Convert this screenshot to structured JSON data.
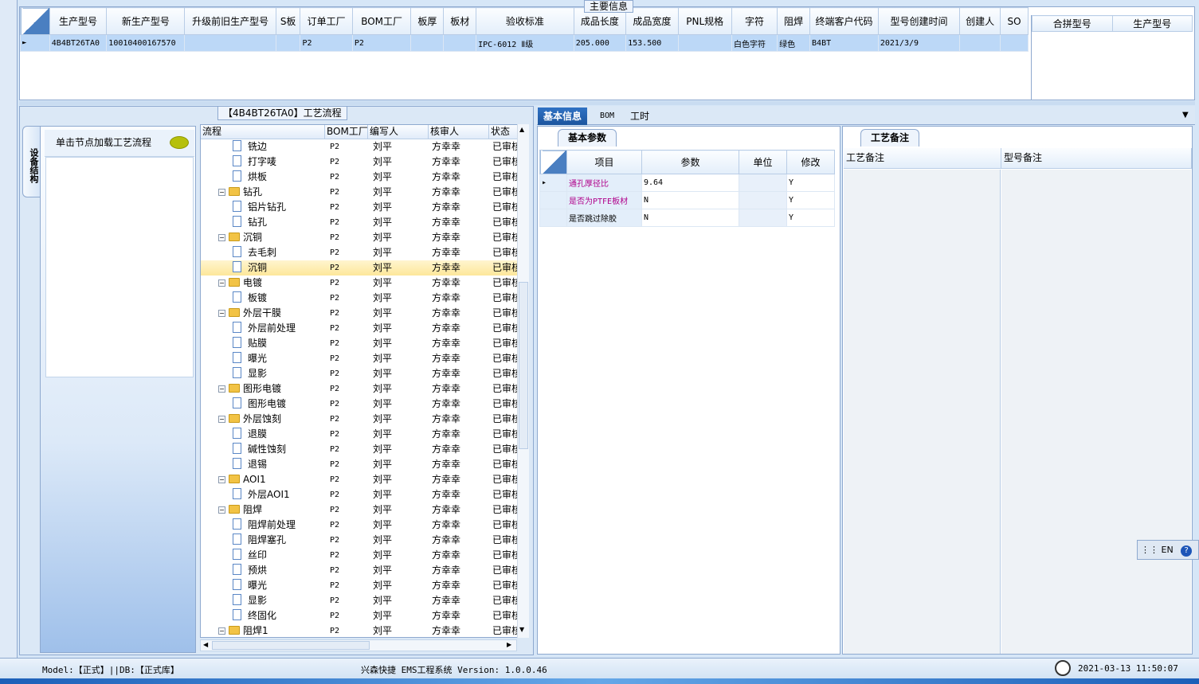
{
  "main_info": {
    "group_title": "主要信息",
    "columns": [
      "生产型号",
      "新生产型号",
      "升级前旧生产型号",
      "S板",
      "订单工厂",
      "BOM工厂",
      "板厚",
      "板材",
      "验收标准",
      "成品长度",
      "成品宽度",
      "PNL规格",
      "字符",
      "阻焊",
      "终端客户代码",
      "型号创建时间",
      "创建人",
      "SO"
    ],
    "row": [
      "4B4BT26TA0",
      "10010400167570",
      "",
      "",
      "P2",
      "P2",
      "",
      "",
      "IPC-6012 Ⅱ级",
      "205.000",
      "153.500",
      "",
      "白色字符",
      "绿色",
      "B4BT",
      "2021/3/9",
      "",
      ""
    ],
    "merge_columns": [
      "合拼型号",
      "生产型号"
    ]
  },
  "flow": {
    "title": "【4B4BT26TA0】工艺流程",
    "vertical_tab": "设备结构",
    "hint": "单击节点加载工艺流程",
    "columns": [
      "流程",
      "BOM工厂",
      "编写人",
      "核审人",
      "状态"
    ],
    "rows": [
      {
        "name": "铣边",
        "level": 2,
        "factory": "P2",
        "writer": "刘平",
        "reviewer": "方幸幸",
        "status": "已审核"
      },
      {
        "name": "打字唛",
        "level": 2,
        "factory": "P2",
        "writer": "刘平",
        "reviewer": "方幸幸",
        "status": "已审核"
      },
      {
        "name": "烘板",
        "level": 2,
        "factory": "P2",
        "writer": "刘平",
        "reviewer": "方幸幸",
        "status": "已审核"
      },
      {
        "name": "钻孔",
        "level": 1,
        "factory": "P2",
        "writer": "刘平",
        "reviewer": "方幸幸",
        "status": "已审核"
      },
      {
        "name": "铝片钻孔",
        "level": 2,
        "factory": "P2",
        "writer": "刘平",
        "reviewer": "方幸幸",
        "status": "已审核"
      },
      {
        "name": "钻孔",
        "level": 2,
        "factory": "P2",
        "writer": "刘平",
        "reviewer": "方幸幸",
        "status": "已审核"
      },
      {
        "name": "沉铜",
        "level": 1,
        "factory": "P2",
        "writer": "刘平",
        "reviewer": "方幸幸",
        "status": "已审核"
      },
      {
        "name": "去毛刺",
        "level": 2,
        "factory": "P2",
        "writer": "刘平",
        "reviewer": "方幸幸",
        "status": "已审核"
      },
      {
        "name": "沉铜",
        "level": 2,
        "factory": "P2",
        "writer": "刘平",
        "reviewer": "方幸幸",
        "status": "已审核",
        "selected": true
      },
      {
        "name": "电镀",
        "level": 1,
        "factory": "P2",
        "writer": "刘平",
        "reviewer": "方幸幸",
        "status": "已审核"
      },
      {
        "name": "板镀",
        "level": 2,
        "factory": "P2",
        "writer": "刘平",
        "reviewer": "方幸幸",
        "status": "已审核"
      },
      {
        "name": "外层干膜",
        "level": 1,
        "factory": "P2",
        "writer": "刘平",
        "reviewer": "方幸幸",
        "status": "已审核"
      },
      {
        "name": "外层前处理",
        "level": 2,
        "factory": "P2",
        "writer": "刘平",
        "reviewer": "方幸幸",
        "status": "已审核"
      },
      {
        "name": "贴膜",
        "level": 2,
        "factory": "P2",
        "writer": "刘平",
        "reviewer": "方幸幸",
        "status": "已审核"
      },
      {
        "name": "曝光",
        "level": 2,
        "factory": "P2",
        "writer": "刘平",
        "reviewer": "方幸幸",
        "status": "已审核"
      },
      {
        "name": "显影",
        "level": 2,
        "factory": "P2",
        "writer": "刘平",
        "reviewer": "方幸幸",
        "status": "已审核"
      },
      {
        "name": "图形电镀",
        "level": 1,
        "factory": "P2",
        "writer": "刘平",
        "reviewer": "方幸幸",
        "status": "已审核"
      },
      {
        "name": "图形电镀",
        "level": 2,
        "factory": "P2",
        "writer": "刘平",
        "reviewer": "方幸幸",
        "status": "已审核"
      },
      {
        "name": "外层蚀刻",
        "level": 1,
        "factory": "P2",
        "writer": "刘平",
        "reviewer": "方幸幸",
        "status": "已审核"
      },
      {
        "name": "退膜",
        "level": 2,
        "factory": "P2",
        "writer": "刘平",
        "reviewer": "方幸幸",
        "status": "已审核"
      },
      {
        "name": "碱性蚀刻",
        "level": 2,
        "factory": "P2",
        "writer": "刘平",
        "reviewer": "方幸幸",
        "status": "已审核"
      },
      {
        "name": "退锡",
        "level": 2,
        "factory": "P2",
        "writer": "刘平",
        "reviewer": "方幸幸",
        "status": "已审核"
      },
      {
        "name": "AOI1",
        "level": 1,
        "factory": "P2",
        "writer": "刘平",
        "reviewer": "方幸幸",
        "status": "已审核"
      },
      {
        "name": "外层AOI1",
        "level": 2,
        "factory": "P2",
        "writer": "刘平",
        "reviewer": "方幸幸",
        "status": "已审核"
      },
      {
        "name": "阻焊",
        "level": 1,
        "factory": "P2",
        "writer": "刘平",
        "reviewer": "方幸幸",
        "status": "已审核"
      },
      {
        "name": "阻焊前处理",
        "level": 2,
        "factory": "P2",
        "writer": "刘平",
        "reviewer": "方幸幸",
        "status": "已审核"
      },
      {
        "name": "阻焊塞孔",
        "level": 2,
        "factory": "P2",
        "writer": "刘平",
        "reviewer": "方幸幸",
        "status": "已审核"
      },
      {
        "name": "丝印",
        "level": 2,
        "factory": "P2",
        "writer": "刘平",
        "reviewer": "方幸幸",
        "status": "已审核"
      },
      {
        "name": "预烘",
        "level": 2,
        "factory": "P2",
        "writer": "刘平",
        "reviewer": "方幸幸",
        "status": "已审核"
      },
      {
        "name": "曝光",
        "level": 2,
        "factory": "P2",
        "writer": "刘平",
        "reviewer": "方幸幸",
        "status": "已审核"
      },
      {
        "name": "显影",
        "level": 2,
        "factory": "P2",
        "writer": "刘平",
        "reviewer": "方幸幸",
        "status": "已审核"
      },
      {
        "name": "终固化",
        "level": 2,
        "factory": "P2",
        "writer": "刘平",
        "reviewer": "方幸幸",
        "status": "已审核"
      },
      {
        "name": "阻焊1",
        "level": 1,
        "factory": "P2",
        "writer": "刘平",
        "reviewer": "方幸幸",
        "status": "已审核"
      }
    ]
  },
  "right": {
    "tabs": [
      "基本信息",
      "BOM",
      "工时"
    ],
    "basic_subtab": "基本参数",
    "param_columns": [
      "项目",
      "参数",
      "单位",
      "修改"
    ],
    "params": [
      {
        "item": "通孔厚径比",
        "value": "9.64",
        "unit": "",
        "modify": "Y",
        "highlight": true
      },
      {
        "item": "是否为PTFE板材",
        "value": "N",
        "unit": "",
        "modify": "Y",
        "highlight": true
      },
      {
        "item": "是否跳过除胶",
        "value": "N",
        "unit": "",
        "modify": "Y",
        "highlight": false
      }
    ],
    "note_subtab": "工艺备注",
    "note_columns": [
      "工艺备注",
      "型号备注"
    ]
  },
  "status_bar": {
    "model_db": "Model:【正式】||DB:【正式库】",
    "app": "兴森快捷 EMS工程系统 Version: 1.0.0.46",
    "datetime": "2021-03-13 11:50:07",
    "lang": "EN"
  },
  "colors": {
    "accent": "#1c559e",
    "selected_row": "#bcd8f7",
    "highlight_text": "#b0008a"
  }
}
